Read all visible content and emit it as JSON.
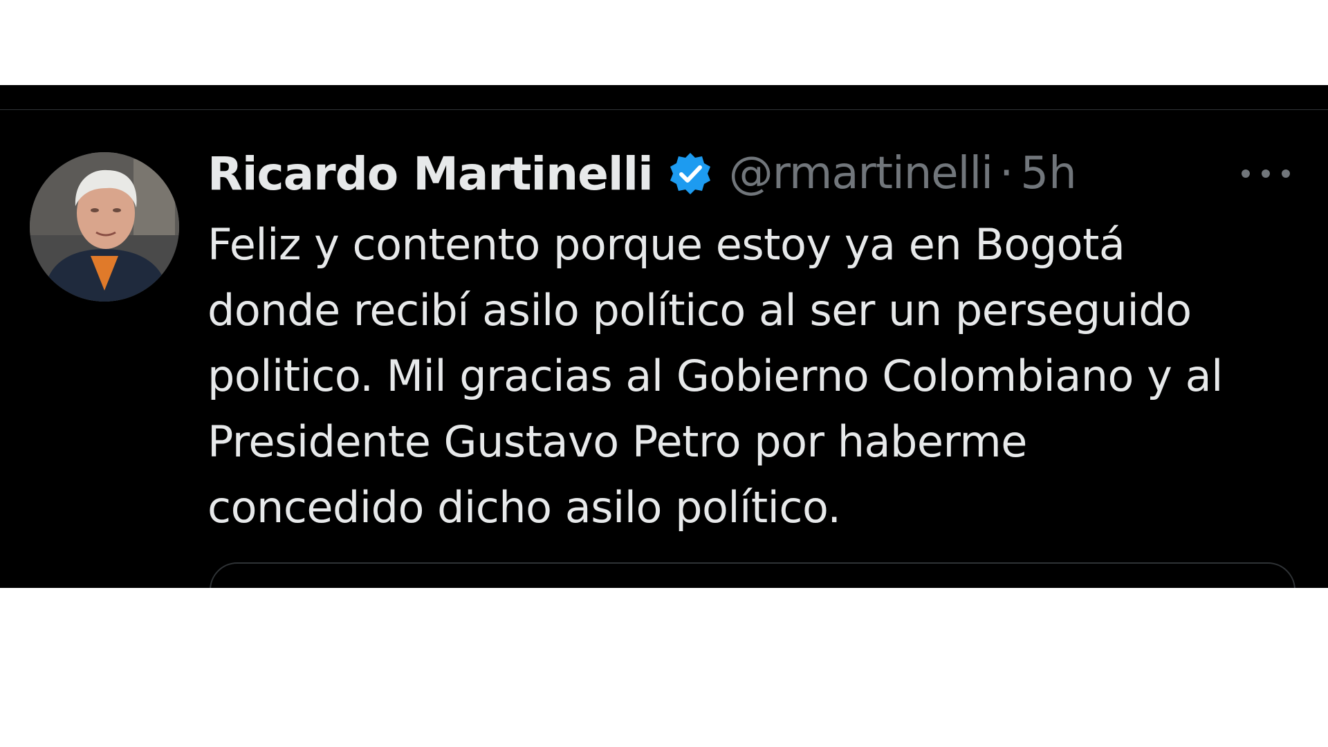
{
  "tweet": {
    "display_name": "Ricardo Martinelli",
    "handle": "@rmartinelli",
    "separator": "·",
    "time": "5h",
    "text_lines": [
      "Feliz y contento porque estoy ya en Bogotá",
      "donde recibí asilo político al ser un perseguido",
      "politico. Mil gracias al Gobierno Colombiano y al",
      "Presidente Gustavo Petro por haberme",
      "concedido dicho asilo político."
    ]
  },
  "icons": {
    "verified": "verified-badge-icon",
    "more": "more-options-icon"
  },
  "colors": {
    "background": "#000000",
    "text": "#e7e9ea",
    "muted": "#71767b",
    "verified_blue": "#1d9bf0",
    "border": "#2f3336"
  }
}
